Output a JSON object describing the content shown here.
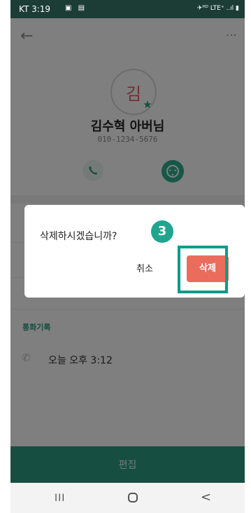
{
  "status_bar": {
    "time": "KT 3:19",
    "left_icons": "▣ ▤",
    "right_icons": "✈ᴴᴰ LTE⁺ ..ıl ▮"
  },
  "app_bar": {
    "back_icon": "←",
    "more_icon": "⋯"
  },
  "contact": {
    "avatar_text": "김",
    "name": "김수혁 아버님",
    "phone": "010-1234-5676"
  },
  "call_history": {
    "section_label": "통화기록",
    "items": [
      {
        "text": "오늘 오후 3:12"
      }
    ]
  },
  "edit_bar": {
    "label": "편집"
  },
  "nav": {
    "recent": "III",
    "back": "<"
  },
  "dialog": {
    "message": "삭제하시겠습니까?",
    "cancel_label": "취소",
    "delete_label": "삭제"
  },
  "annotation": {
    "step_number": "3",
    "highlight_color": "#0b9b8a"
  },
  "colors": {
    "accent": "#2c9e85",
    "delete": "#ea6d5c",
    "status_bar": "#1c3d36"
  }
}
